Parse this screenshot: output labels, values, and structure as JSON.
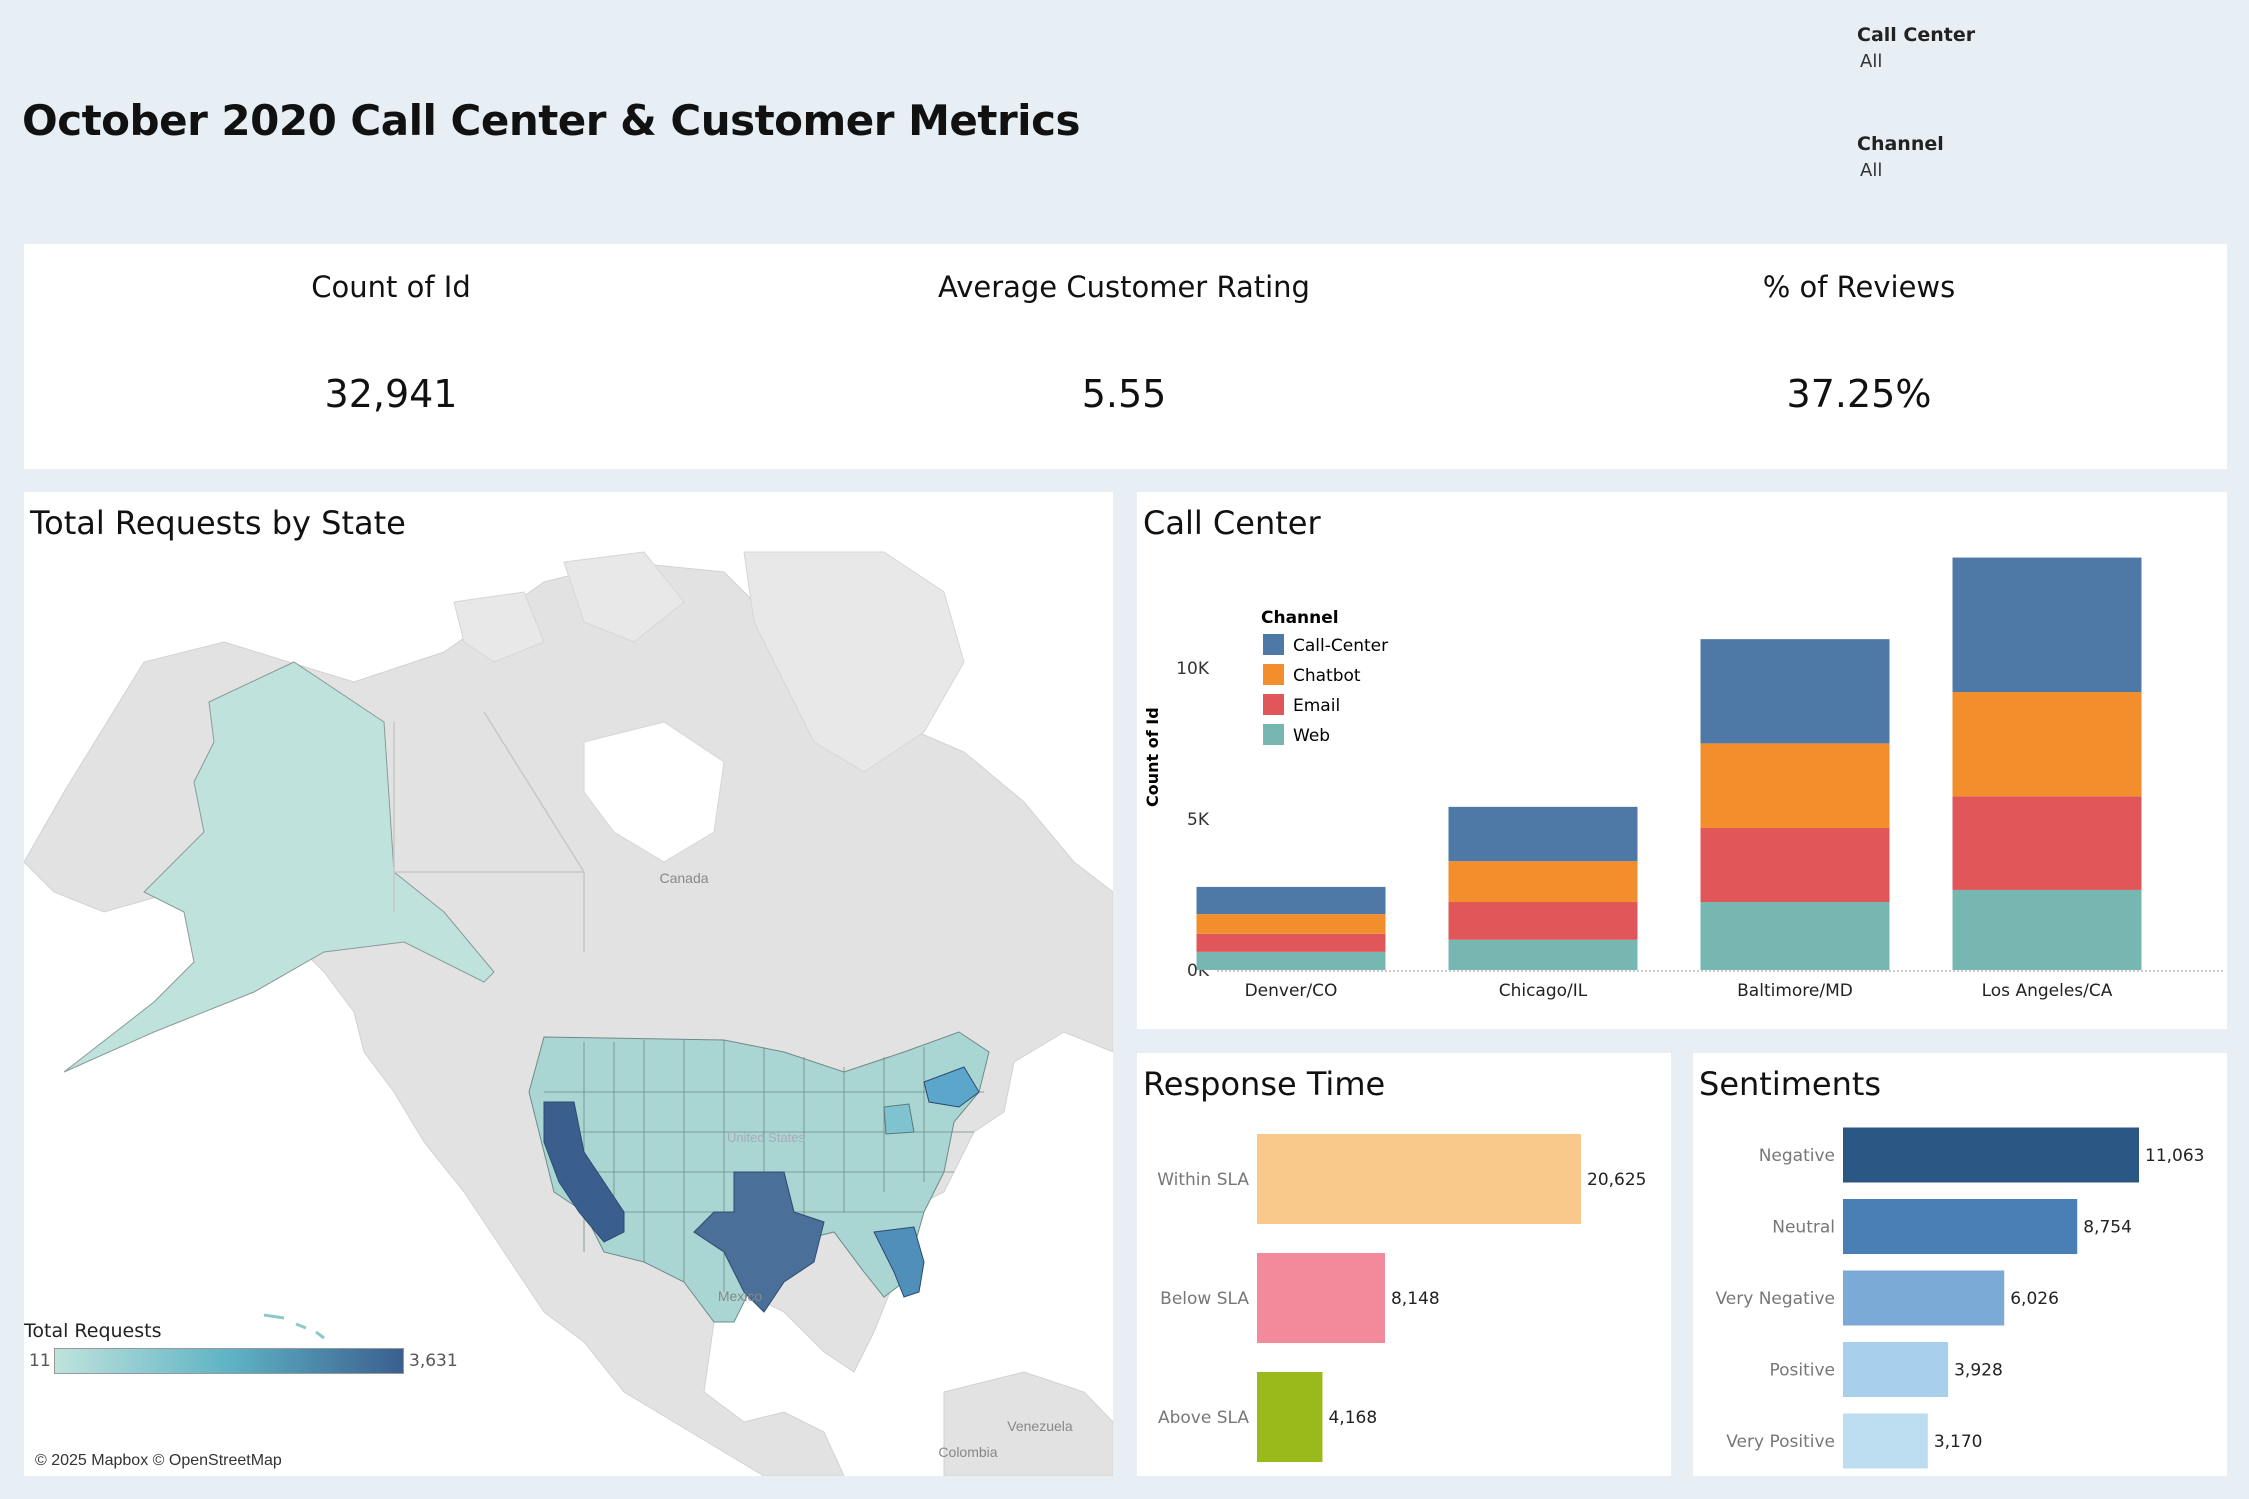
{
  "title": "October 2020 Call Center & Customer Metrics",
  "filters": [
    {
      "label": "Call Center",
      "value": "All"
    },
    {
      "label": "Channel",
      "value": "All"
    }
  ],
  "kpis": [
    {
      "label": "Count of Id",
      "value": "32,941"
    },
    {
      "label": "Average Customer Rating",
      "value": "5.55"
    },
    {
      "label": "% of Reviews",
      "value": "37.25%"
    }
  ],
  "map": {
    "title": "Total Requests by State",
    "country_labels": [
      "Canada",
      "United States",
      "Mexico",
      "Venezuela",
      "Colombia"
    ],
    "legend_title": "Total Requests",
    "legend_min": "11",
    "legend_max": "3,631",
    "attribution": "© 2025 Mapbox © OpenStreetMap",
    "colors": {
      "low": "#bfe3dc",
      "mid": "#5fb3c4",
      "high": "#3a5f8f",
      "land": "#e2e2e2",
      "water": "#ffffff"
    }
  },
  "call_center_chart": {
    "title": "Call Center",
    "legend_title": "Channel",
    "y_axis_label": "Count of Id",
    "y_ticks": [
      "0K",
      "5K",
      "10K"
    ],
    "colors": {
      "Call-Center": "#4e79a7",
      "Chatbot": "#f28e2b",
      "Email": "#e15759",
      "Web": "#76b7b2"
    }
  },
  "response_chart": {
    "title": "Response Time",
    "colors": [
      "#f8c98b",
      "#f28a9c",
      "#9aba1c"
    ]
  },
  "sentiment_chart": {
    "title": "Sentiments",
    "colors": [
      "#2a5783",
      "#4a7fb5",
      "#7caad6",
      "#a8cfec",
      "#bcdcf0"
    ]
  },
  "chart_data": [
    {
      "type": "bar",
      "stacked": true,
      "title": "Call Center",
      "categories": [
        "Denver/CO",
        "Chicago/IL",
        "Baltimore/MD",
        "Los Angeles/CA"
      ],
      "series": [
        {
          "name": "Web",
          "values": [
            600,
            1000,
            2250,
            2650
          ]
        },
        {
          "name": "Email",
          "values": [
            600,
            1250,
            2450,
            3100
          ]
        },
        {
          "name": "Chatbot",
          "values": [
            650,
            1350,
            2800,
            3450
          ]
        },
        {
          "name": "Call-Center",
          "values": [
            900,
            1800,
            3450,
            4450
          ]
        }
      ],
      "ylabel": "Count of Id",
      "ylim": [
        0,
        14000
      ],
      "legend": "top-left"
    },
    {
      "type": "bar",
      "orientation": "horizontal",
      "title": "Response Time",
      "categories": [
        "Within SLA",
        "Below SLA",
        "Above SLA"
      ],
      "values": [
        20625,
        8148,
        4168
      ],
      "value_labels": [
        "20,625",
        "8,148",
        "4,168"
      ]
    },
    {
      "type": "bar",
      "orientation": "horizontal",
      "title": "Sentiments",
      "categories": [
        "Negative",
        "Neutral",
        "Very Negative",
        "Positive",
        "Very Positive"
      ],
      "values": [
        11063,
        8754,
        6026,
        3928,
        3170
      ],
      "value_labels": [
        "11,063",
        "8,754",
        "6,026",
        "3,928",
        "3,170"
      ]
    }
  ]
}
